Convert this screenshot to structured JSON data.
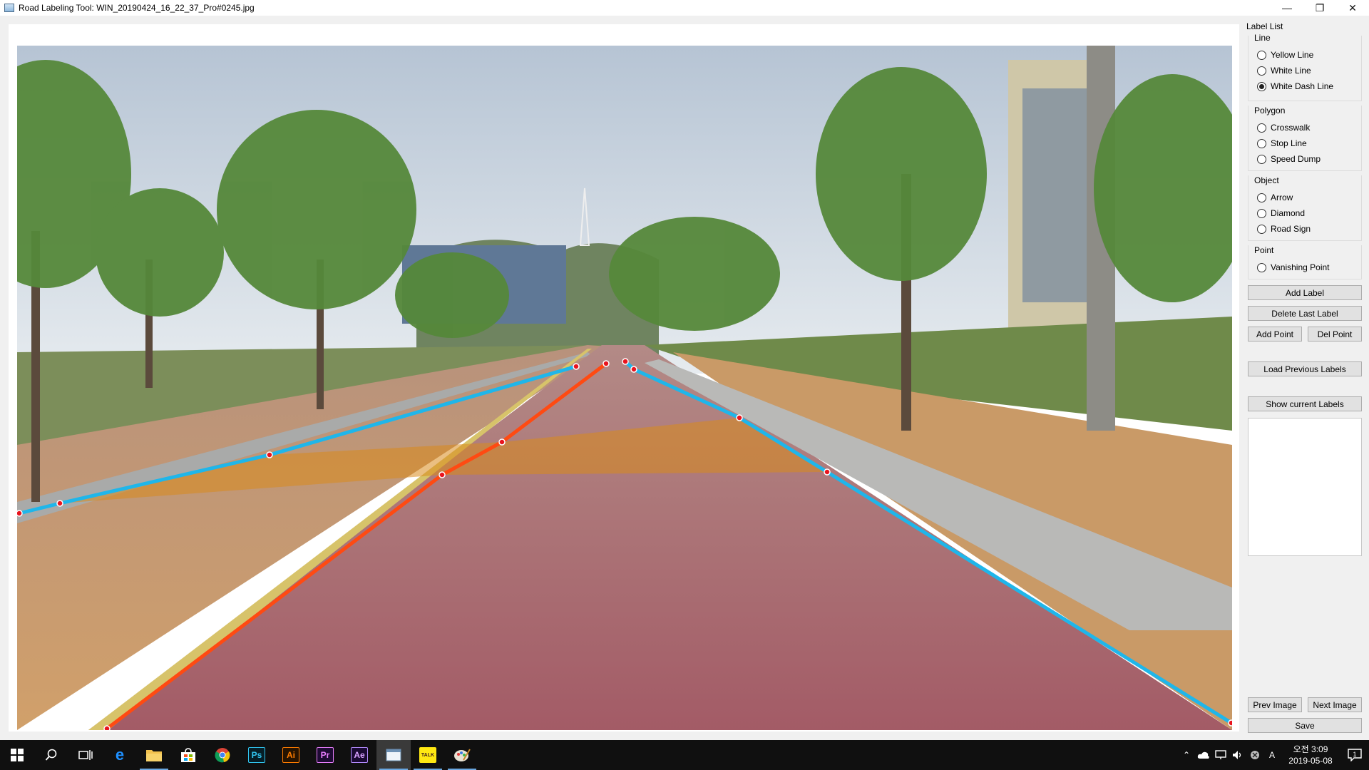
{
  "window": {
    "title": "Road Labeling Tool: WIN_20190424_16_22_37_Pro#0245.jpg",
    "controls": {
      "minimize": "—",
      "restore": "❐",
      "close": "✕"
    }
  },
  "panel": {
    "title": "Label List",
    "groups": [
      {
        "title": "Line",
        "options": [
          {
            "label": "Yellow Line",
            "checked": false
          },
          {
            "label": "White Line",
            "checked": false
          },
          {
            "label": "White Dash Line",
            "checked": true
          }
        ]
      },
      {
        "title": "Polygon",
        "options": [
          {
            "label": "Crosswalk",
            "checked": false
          },
          {
            "label": "Stop Line",
            "checked": false
          },
          {
            "label": "Speed Dump",
            "checked": false
          }
        ]
      },
      {
        "title": "Object",
        "options": [
          {
            "label": "Arrow",
            "checked": false
          },
          {
            "label": "Diamond",
            "checked": false
          },
          {
            "label": "Road Sign",
            "checked": false
          }
        ]
      },
      {
        "title": "Point",
        "options": [
          {
            "label": "Vanishing Point",
            "checked": false
          }
        ]
      }
    ],
    "buttons": {
      "add_label": "Add Label",
      "delete_last_label": "Delete Last Label",
      "add_point": "Add Point",
      "del_point": "Del Point",
      "load_previous_labels": "Load Previous Labels",
      "show_current_labels": "Show current Labels",
      "prev_image": "Prev Image",
      "next_image": "Next Image",
      "save": "Save"
    }
  },
  "annotation_colors": {
    "white_line": "#1fb6ea",
    "yellow_line": "#ff4a12",
    "speed_bump_fill": "#d98a1c",
    "point_marker": "#e8141e"
  },
  "taskbar": {
    "apps": [
      {
        "name": "start",
        "icon": "windows-logo-icon"
      },
      {
        "name": "search",
        "icon": "search-icon"
      },
      {
        "name": "task-view",
        "icon": "task-view-icon"
      },
      {
        "name": "edge",
        "icon": "edge-icon",
        "glyph": "e"
      },
      {
        "name": "file-explorer",
        "icon": "folder-icon",
        "open": true
      },
      {
        "name": "store",
        "icon": "store-icon"
      },
      {
        "name": "chrome",
        "icon": "chrome-icon"
      },
      {
        "name": "photoshop",
        "icon": "photoshop-icon",
        "glyph": "Ps"
      },
      {
        "name": "illustrator",
        "icon": "illustrator-icon",
        "glyph": "Ai"
      },
      {
        "name": "premiere",
        "icon": "premiere-icon",
        "glyph": "Pr"
      },
      {
        "name": "after-effects",
        "icon": "after-effects-icon",
        "glyph": "Ae"
      },
      {
        "name": "labeling-tool",
        "icon": "labeling-tool-icon",
        "active": true,
        "open": true
      },
      {
        "name": "kakaotalk",
        "icon": "kakaotalk-icon",
        "glyph": "TALK",
        "open": true
      },
      {
        "name": "paint",
        "icon": "paint-icon",
        "open": true
      }
    ],
    "tray": {
      "ime": "A",
      "time": "오전 3:09",
      "date": "2019-05-08",
      "notification_count": "1"
    }
  }
}
